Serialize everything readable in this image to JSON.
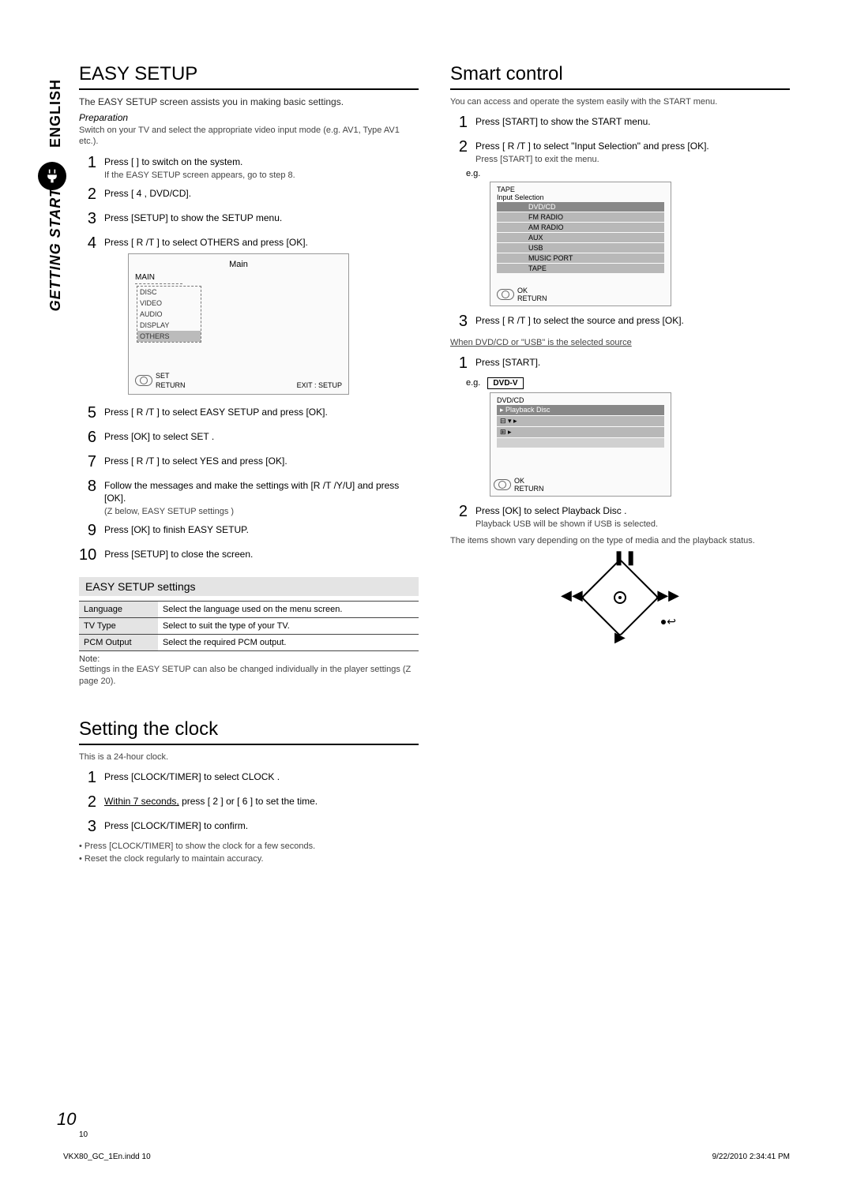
{
  "side": {
    "english": "ENGLISH",
    "getting": "GETTING STARTED"
  },
  "left": {
    "title": "EASY SETUP",
    "intro": "The EASY SETUP screen assists you in making basic settings.",
    "prep": "Preparation",
    "prep_line1": "Switch on your TV and select the appropriate video input mode (e.g. AV1, Type AV1 etc.).",
    "steps": [
      {
        "n": "1",
        "t": "Press [  ] to switch on the system.",
        "sub": "If the EASY SETUP screen appears, go to step 8."
      },
      {
        "n": "2",
        "t": "Press [ 4 , DVD/CD]."
      },
      {
        "n": "3",
        "t": "Press [SETUP] to show the SETUP menu."
      },
      {
        "n": "4",
        "t": "Press [ R /T ] to select  OTHERS  and press [OK]."
      },
      {
        "n": "5",
        "t": "Press [ R /T ] to select  EASY SETUP  and press [OK]."
      },
      {
        "n": "6",
        "t": "Press [OK] to select  SET ."
      },
      {
        "n": "7",
        "t": "Press [ R /T ] to select  YES  and press [OK]."
      },
      {
        "n": "8",
        "t": "Follow the messages and make the settings with [R /T /Y/U] and press [OK].",
        "sub": "(Z  below, EASY SETUP settings )"
      },
      {
        "n": "9",
        "t": "Press [OK] to finish EASY SETUP."
      },
      {
        "n": "10",
        "t": "Press [SETUP] to close the screen."
      }
    ],
    "menu": {
      "title": "Main",
      "main": "MAIN",
      "items": [
        "DISC",
        "VIDEO",
        "AUDIO",
        "DISPLAY",
        "OTHERS"
      ],
      "set": "SET",
      "ret": "RETURN",
      "exit": "EXIT : SETUP"
    },
    "settings_head": "EASY SETUP settings",
    "settings": [
      {
        "a": "Language",
        "b": "Select the language used on the menu screen."
      },
      {
        "a": "TV Type",
        "b": "Select to suit the type of your TV."
      },
      {
        "a": "PCM Output",
        "b": "Select the required PCM output."
      }
    ],
    "note_label": "Note:",
    "note": "Settings in the EASY SETUP can also be changed individually in the player settings (Z page 20).",
    "clock_title": "Setting the clock",
    "clock_intro": "This is a 24-hour clock.",
    "clock_steps": [
      {
        "n": "1",
        "t": "Press [CLOCK/TIMER] to select  CLOCK ."
      },
      {
        "n": "2",
        "t": "Within 7 seconds, press [ 2     ] or [ 6     ] to set the time.",
        "u": "Within 7 seconds,"
      },
      {
        "n": "3",
        "t": "Press [CLOCK/TIMER] to confirm."
      }
    ],
    "clock_notes": [
      "• Press [CLOCK/TIMER] to show the clock for a few seconds.",
      "• Reset the clock regularly to maintain accuracy."
    ]
  },
  "right": {
    "title": "Smart control",
    "intro1": "You can access and operate the system easily with the START menu.",
    "steps_a": [
      {
        "n": "1",
        "t": "Press [START] to show the START menu."
      },
      {
        "n": "2",
        "t": "Press [ R /T ] to select  \"Input Selection\"  and press [OK].",
        "sub": "Press [START] to exit the menu."
      }
    ],
    "eg": "e.g.",
    "input_box": {
      "tape": "TAPE",
      "title": "Input Selection",
      "items": [
        "DVD/CD",
        "FM RADIO",
        "AM RADIO",
        "AUX",
        "USB",
        "MUSIC PORT",
        "TAPE"
      ],
      "ok": "OK",
      "ret": "RETURN"
    },
    "step3": {
      "n": "3",
      "t": "Press [ R /T ] to select the source and press [OK]."
    },
    "when": "When  DVD/CD  or  \"USB\" is the selected source",
    "steps_b": [
      {
        "n": "1",
        "t": "Press [START]."
      }
    ],
    "eg2": "e.g.",
    "dvdv": "DVD-V",
    "playback": {
      "hdr": "DVD/CD",
      "rows": [
        "Playback Disc",
        " ",
        " ",
        " "
      ],
      "ok": "OK",
      "ret": "RETURN"
    },
    "step_b2": {
      "n": "2",
      "t": "Press [OK] to select  Playback Disc .",
      "sub": "Playback USB  will be shown if USB is selected."
    },
    "remote_note1": "The items shown vary depending on the type of media and the playback status.",
    "remote_note2": " "
  },
  "page": {
    "num": "10",
    "small": "10"
  },
  "footer": {
    "left": "VKX80_GC_1En.indd   10",
    "right": "9/22/2010   2:34:41 PM"
  }
}
